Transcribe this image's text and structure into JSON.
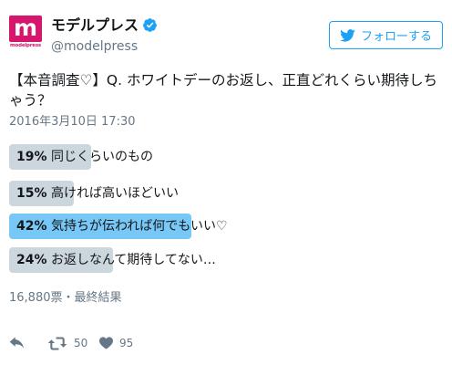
{
  "account": {
    "name": "モデルプレス",
    "handle": "@modelpress",
    "avatar_letter": "m",
    "avatar_subtext": "modelpress",
    "brand_color": "#d6156c",
    "verified": true
  },
  "follow_button": {
    "label": "フォローする",
    "icon": "twitter-bird-icon",
    "color": "#1da1f2"
  },
  "tweet": {
    "text": "【本音調査♡】Q. ホワイトデーのお返し、正直どれくらい期待しちゃう？",
    "timestamp": "2016年3月10日 17:30"
  },
  "poll": {
    "options": [
      {
        "percent_label": "19%",
        "percent": 19,
        "label": "同じくらいのもの",
        "winner": false
      },
      {
        "percent_label": "15%",
        "percent": 15,
        "label": "高ければ高いほどいい",
        "winner": false
      },
      {
        "percent_label": "42%",
        "percent": 42,
        "label": "気持ちが伝われば何でもいい♡",
        "winner": true
      },
      {
        "percent_label": "24%",
        "percent": 24,
        "label": "お返しなんて期待してない…",
        "winner": false
      }
    ],
    "meta": "16,880票・最終結果",
    "bar_color": "#ccd6dd",
    "winner_color": "#77c7f7"
  },
  "actions": {
    "reply": {
      "icon": "reply-icon"
    },
    "retweet": {
      "icon": "retweet-icon",
      "count": "50"
    },
    "like": {
      "icon": "heart-icon",
      "count": "95"
    }
  }
}
